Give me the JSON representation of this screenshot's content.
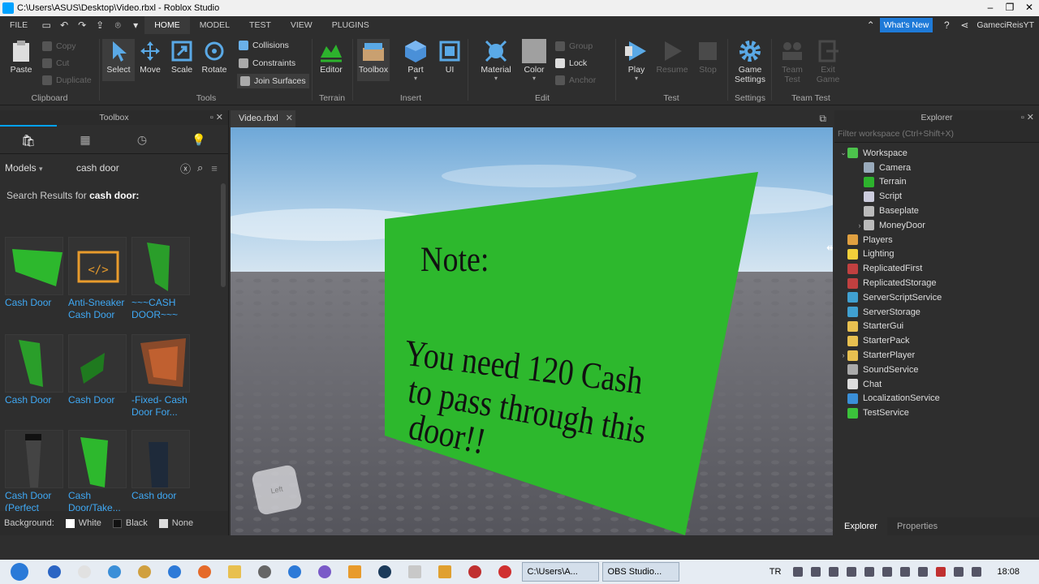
{
  "window": {
    "title": "C:\\Users\\ASUS\\Desktop\\Video.rbxl - Roblox Studio",
    "controls": [
      "–",
      "❐",
      "✕"
    ]
  },
  "menubar": {
    "file": "FILE",
    "tabs": [
      "HOME",
      "MODEL",
      "TEST",
      "VIEW",
      "PLUGINS"
    ],
    "active_tab": "HOME",
    "whats_new": "What's New",
    "user": "GameciReisYT"
  },
  "ribbon": {
    "clipboard": {
      "label": "Clipboard",
      "paste": "Paste",
      "copy": "Copy",
      "cut": "Cut",
      "duplicate": "Duplicate"
    },
    "tools": {
      "label": "Tools",
      "select": "Select",
      "move": "Move",
      "scale": "Scale",
      "rotate": "Rotate",
      "collisions": "Collisions",
      "constraints": "Constraints",
      "join_surfaces": "Join Surfaces"
    },
    "terrain": {
      "label": "Terrain",
      "editor": "Editor"
    },
    "insert": {
      "label": "Insert",
      "toolbox": "Toolbox",
      "part": "Part",
      "ui": "UI"
    },
    "edit": {
      "label": "Edit",
      "material": "Material",
      "color": "Color",
      "group": "Group",
      "lock": "Lock",
      "anchor": "Anchor"
    },
    "test": {
      "label": "Test",
      "play": "Play",
      "resume": "Resume",
      "stop": "Stop"
    },
    "settings": {
      "label": "Settings",
      "game_settings": "Game Settings"
    },
    "team_test": {
      "label": "Team Test",
      "team_test": "Team Test",
      "exit_game": "Exit Game"
    }
  },
  "toolbox": {
    "title": "Toolbox",
    "category": "Models",
    "search_value": "cash door",
    "results_prefix": "Search Results for",
    "results_query": "cash door:",
    "items": [
      {
        "name": "Cash Door"
      },
      {
        "name": "Anti-Sneaker Cash Door"
      },
      {
        "name": "~~~CASH DOOR~~~"
      },
      {
        "name": "Cash Door"
      },
      {
        "name": "Cash Door"
      },
      {
        "name": "-Fixed- Cash Door For..."
      },
      {
        "name": "Cash Door (Perfect For..."
      },
      {
        "name": "Cash Door/Take..."
      },
      {
        "name": "Cash door"
      }
    ],
    "background_label": "Background:",
    "bg_options": [
      "White",
      "Black",
      "None"
    ]
  },
  "document": {
    "tab": "Video.rbxl"
  },
  "viewport": {
    "sign_line1": "Note:",
    "sign_line2": "You need 120 Cash",
    "sign_line3": "to pass through this",
    "sign_line4": "door!!",
    "sign_color": "#2db82d",
    "cube_label": "Left"
  },
  "explorer": {
    "title": "Explorer",
    "filter_placeholder": "Filter workspace (Ctrl+Shift+X)",
    "tree": [
      {
        "label": "Workspace",
        "icon": "globe-icon",
        "color": "#4cc24c",
        "expanded": "⌄"
      },
      {
        "label": "Camera",
        "icon": "camera-icon",
        "color": "#9ab"
      },
      {
        "label": "Terrain",
        "icon": "terrain-icon",
        "color": "#2db32d"
      },
      {
        "label": "Script",
        "icon": "script-icon",
        "color": "#ccd"
      },
      {
        "label": "Baseplate",
        "icon": "part-icon",
        "color": "#bbb"
      },
      {
        "label": "MoneyDoor",
        "icon": "model-icon",
        "color": "#bbb",
        "expanded": "›"
      },
      {
        "label": "Players",
        "icon": "players-icon",
        "color": "#e0a040"
      },
      {
        "label": "Lighting",
        "icon": "lightbulb-icon",
        "color": "#f2d03a"
      },
      {
        "label": "ReplicatedFirst",
        "icon": "replicated-icon",
        "color": "#c04040"
      },
      {
        "label": "ReplicatedStorage",
        "icon": "replicated-icon",
        "color": "#c04040"
      },
      {
        "label": "ServerScriptService",
        "icon": "server-icon",
        "color": "#40a0d0"
      },
      {
        "label": "ServerStorage",
        "icon": "server-icon",
        "color": "#40a0d0"
      },
      {
        "label": "StarterGui",
        "icon": "folder-icon",
        "color": "#e8c050"
      },
      {
        "label": "StarterPack",
        "icon": "folder-icon",
        "color": "#e8c050"
      },
      {
        "label": "StarterPlayer",
        "icon": "folder-icon",
        "color": "#e8c050",
        "expanded": "›"
      },
      {
        "label": "SoundService",
        "icon": "sound-icon",
        "color": "#aaa"
      },
      {
        "label": "Chat",
        "icon": "chat-icon",
        "color": "#ddd"
      },
      {
        "label": "LocalizationService",
        "icon": "localization-icon",
        "color": "#3a8fd8"
      },
      {
        "label": "TestService",
        "icon": "check-icon",
        "color": "#3bc23b"
      }
    ],
    "tabs": [
      "Explorer",
      "Properties"
    ]
  },
  "taskbar": {
    "task1": "C:\\Users\\A...",
    "task2": "OBS Studio...",
    "lang": "TR",
    "time": "18:08"
  }
}
